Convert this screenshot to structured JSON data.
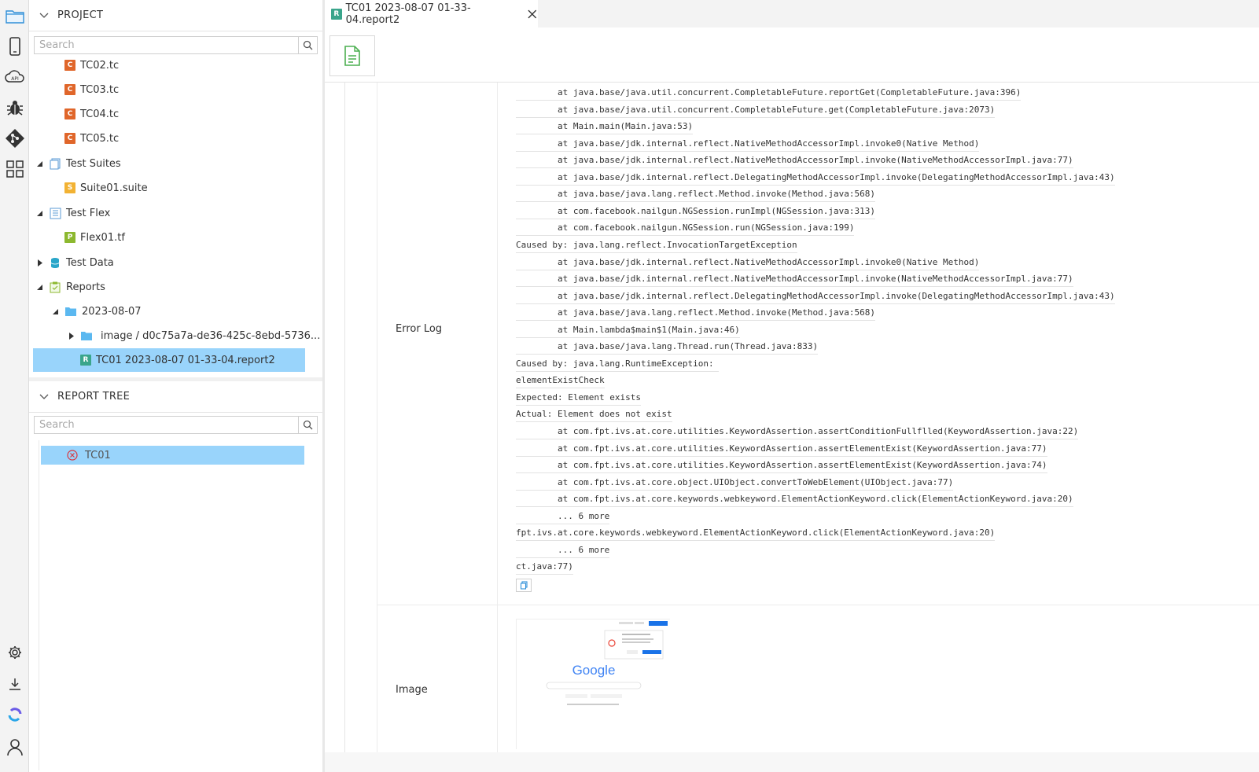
{
  "project": {
    "header": "PROJECT",
    "search_placeholder": "Search",
    "items": [
      {
        "label": "TC02.tc",
        "badge": "C"
      },
      {
        "label": "TC03.tc",
        "badge": "C"
      },
      {
        "label": "TC04.tc",
        "badge": "C"
      },
      {
        "label": "TC05.tc",
        "badge": "C"
      },
      {
        "label": "Test Suites"
      },
      {
        "label": "Suite01.suite",
        "badge": "S"
      },
      {
        "label": "Test Flex"
      },
      {
        "label": "Flex01.tf",
        "badge": "P"
      },
      {
        "label": "Test Data"
      },
      {
        "label": "Reports"
      },
      {
        "label": "2023-08-07"
      },
      {
        "label": "image / d0c75a7a-de36-425c-8ebd-5736..."
      },
      {
        "label": "TC01 2023-08-07 01-33-04.report2",
        "badge": "R"
      }
    ]
  },
  "report_tree": {
    "header": "REPORT TREE",
    "search_placeholder": "Search",
    "items": [
      {
        "label": "TC01",
        "status": "failed"
      }
    ]
  },
  "tab": {
    "label": "TC01 2023-08-07 01-33-04.report2",
    "badge": "R"
  },
  "detail": {
    "error_label": "Error Log",
    "image_label": "Image",
    "log_lines": [
      "        at java.base/java.util.concurrent.CompletableFuture.reportGet(CompletableFuture.java:396)",
      "        at java.base/java.util.concurrent.CompletableFuture.get(CompletableFuture.java:2073)",
      "        at Main.main(Main.java:53)",
      "        at java.base/jdk.internal.reflect.NativeMethodAccessorImpl.invoke0(Native Method)",
      "        at java.base/jdk.internal.reflect.NativeMethodAccessorImpl.invoke(NativeMethodAccessorImpl.java:77)",
      "        at java.base/jdk.internal.reflect.DelegatingMethodAccessorImpl.invoke(DelegatingMethodAccessorImpl.java:43)",
      "        at java.base/java.lang.reflect.Method.invoke(Method.java:568)",
      "        at com.facebook.nailgun.NGSession.runImpl(NGSession.java:313)",
      "        at com.facebook.nailgun.NGSession.run(NGSession.java:199)",
      "Caused by: java.lang.reflect.InvocationTargetException",
      "        at java.base/jdk.internal.reflect.NativeMethodAccessorImpl.invoke0(Native Method)",
      "        at java.base/jdk.internal.reflect.NativeMethodAccessorImpl.invoke(NativeMethodAccessorImpl.java:77)",
      "        at java.base/jdk.internal.reflect.DelegatingMethodAccessorImpl.invoke(DelegatingMethodAccessorImpl.java:43)",
      "        at java.base/java.lang.reflect.Method.invoke(Method.java:568)",
      "        at Main.lambda$main$1(Main.java:46)",
      "        at java.base/java.lang.Thread.run(Thread.java:833)",
      "Caused by: java.lang.RuntimeException: ",
      "elementExistCheck",
      "Expected: Element exists",
      "Actual: Element does not exist",
      "        at com.fpt.ivs.at.core.utilities.KeywordAssertion.assertConditionFullflled(KeywordAssertion.java:22)",
      "        at com.fpt.ivs.at.core.utilities.KeywordAssertion.assertElementExist(KeywordAssertion.java:77)",
      "        at com.fpt.ivs.at.core.utilities.KeywordAssertion.assertElementExist(KeywordAssertion.java:74)",
      "        at com.fpt.ivs.at.core.object.UIObject.convertToWebElement(UIObject.java:77)",
      "        at com.fpt.ivs.at.core.keywords.webkeyword.ElementActionKeyword.click(ElementActionKeyword.java:20)",
      "        ... 6 more",
      "fpt.ivs.at.core.keywords.webkeyword.ElementActionKeyword.click(ElementActionKeyword.java:20)",
      "        ... 6 more",
      "ct.java:77)"
    ],
    "thumbnail": {
      "logo": "Google"
    }
  },
  "colors": {
    "selected": "#99d4fb",
    "badge_c": "#e0662a",
    "badge_s": "#f2b233",
    "badge_p": "#8cb82f",
    "badge_r": "#3aa58b",
    "google_blue": "#1a73e8"
  }
}
